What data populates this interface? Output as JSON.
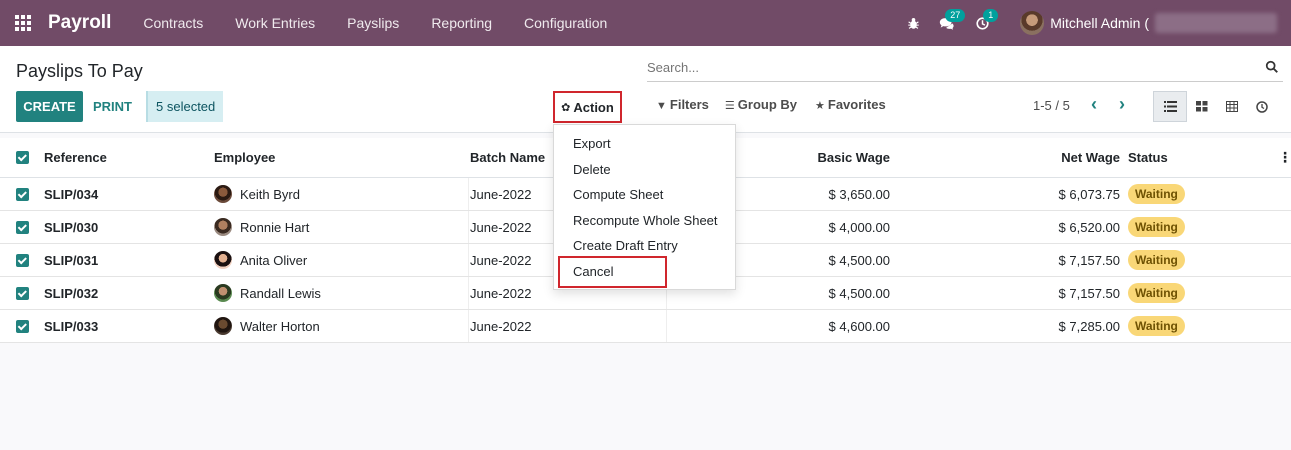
{
  "navbar": {
    "brand": "Payroll",
    "menu": [
      "Contracts",
      "Work Entries",
      "Payslips",
      "Reporting",
      "Configuration"
    ],
    "messages_count": "27",
    "activity_count": "1",
    "user_name": "Mitchell Admin ("
  },
  "control_panel": {
    "title": "Payslips To Pay",
    "create_label": "CREATE",
    "print_label": "PRINT",
    "selected_label": "5 selected",
    "action_label": "Action",
    "search_placeholder": "Search...",
    "filters_label": "Filters",
    "group_by_label": "Group By",
    "favorites_label": "Favorites",
    "pager": "1-5 / 5"
  },
  "action_menu": {
    "items": [
      "Export",
      "Delete",
      "Compute Sheet",
      "Recompute Whole Sheet",
      "Create Draft Entry",
      "Cancel"
    ]
  },
  "table": {
    "headers": {
      "reference": "Reference",
      "employee": "Employee",
      "batch": "Batch Name",
      "basic_wage": "Basic Wage",
      "net_wage": "Net Wage",
      "status": "Status"
    },
    "rows": [
      {
        "reference": "SLIP/034",
        "employee": "Keith Byrd",
        "batch": "June-2022",
        "basic_wage": "$ 3,650.00",
        "net_wage": "$ 6,073.75",
        "status": "Waiting"
      },
      {
        "reference": "SLIP/030",
        "employee": "Ronnie Hart",
        "batch": "June-2022",
        "basic_wage": "$ 4,000.00",
        "net_wage": "$ 6,520.00",
        "status": "Waiting"
      },
      {
        "reference": "SLIP/031",
        "employee": "Anita Oliver",
        "batch": "June-2022",
        "basic_wage": "$ 4,500.00",
        "net_wage": "$ 7,157.50",
        "status": "Waiting"
      },
      {
        "reference": "SLIP/032",
        "employee": "Randall Lewis",
        "batch": "June-2022",
        "basic_wage": "$ 4,500.00",
        "net_wage": "$ 7,157.50",
        "status": "Waiting"
      },
      {
        "reference": "SLIP/033",
        "employee": "Walter Horton",
        "batch": "June-2022",
        "basic_wage": "$ 4,600.00",
        "net_wage": "$ 7,285.00",
        "status": "Waiting"
      }
    ]
  },
  "colors": {
    "navbar": "#714b67",
    "primary": "#21827f",
    "highlight_border": "#d0262d",
    "status_badge": "#f9d777"
  }
}
